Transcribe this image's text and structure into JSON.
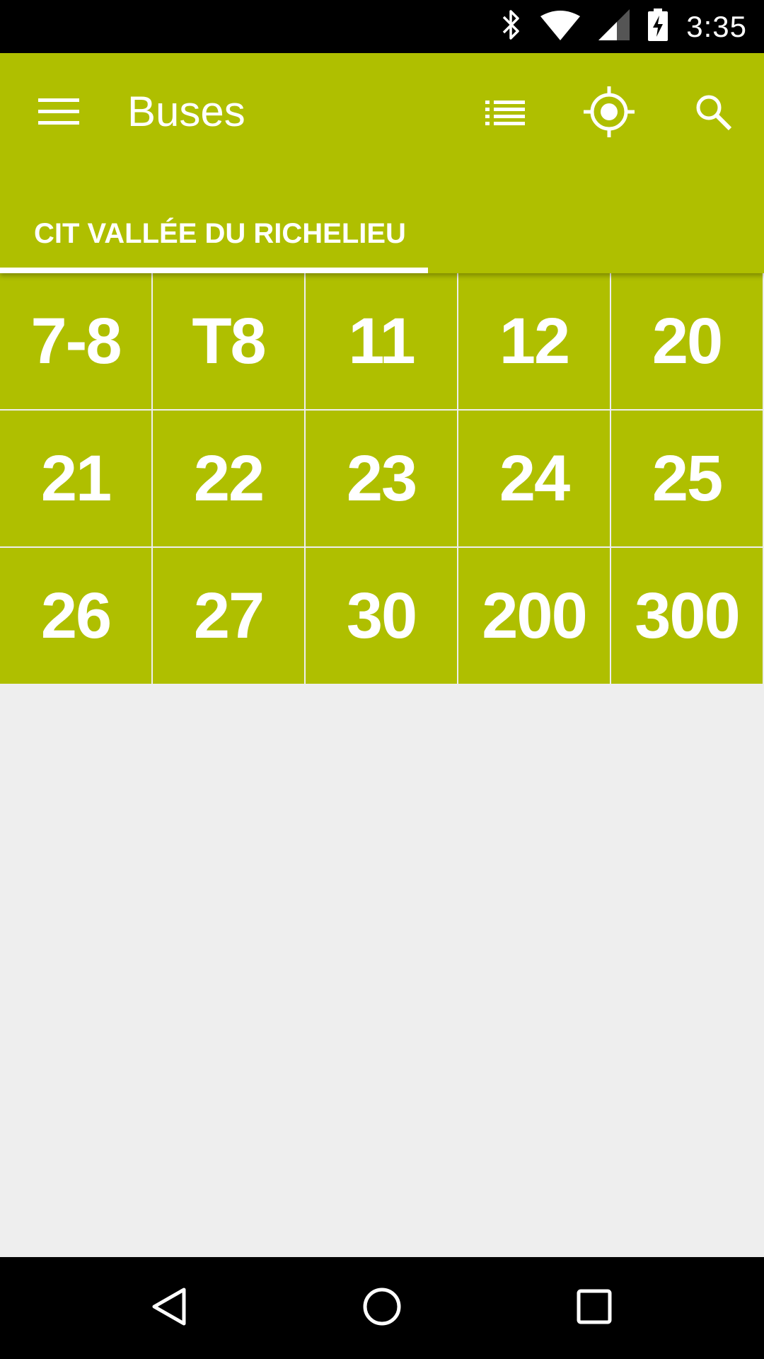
{
  "status_bar": {
    "time": "3:35",
    "icons": [
      "bluetooth-icon",
      "wifi-icon",
      "cell-signal-icon",
      "battery-charging-icon"
    ]
  },
  "toolbar": {
    "title": "Buses",
    "menu_icon": "menu-icon",
    "actions": [
      "list-view-icon",
      "my-location-icon",
      "search-icon"
    ]
  },
  "tabs": [
    {
      "label": "CIT VALLÉE DU RICHELIEU",
      "selected": true
    }
  ],
  "routes": [
    "7-8",
    "T8",
    "11",
    "12",
    "20",
    "21",
    "22",
    "23",
    "24",
    "25",
    "26",
    "27",
    "30",
    "200",
    "300"
  ],
  "nav_bar": {
    "buttons": [
      "back-icon",
      "home-icon",
      "recents-icon"
    ]
  },
  "colors": {
    "primary": "#AFBF00",
    "background": "#EEEEEE",
    "text_on_primary": "#FFFFFF"
  }
}
